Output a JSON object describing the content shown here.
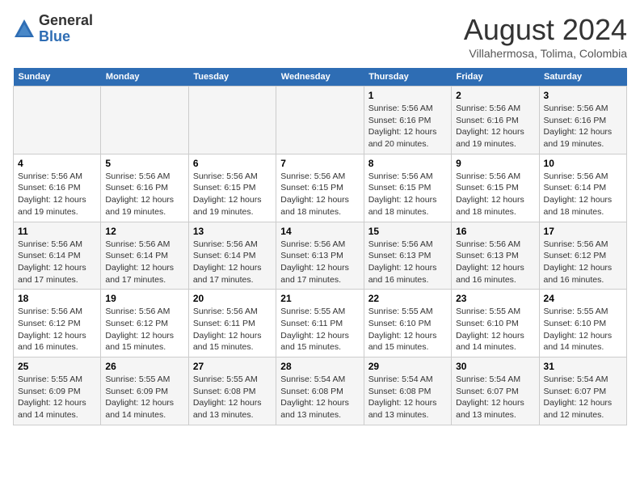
{
  "header": {
    "logo_general": "General",
    "logo_blue": "Blue",
    "month_year": "August 2024",
    "location": "Villahermosa, Tolima, Colombia"
  },
  "weekdays": [
    "Sunday",
    "Monday",
    "Tuesday",
    "Wednesday",
    "Thursday",
    "Friday",
    "Saturday"
  ],
  "weeks": [
    [
      {
        "day": "",
        "info": ""
      },
      {
        "day": "",
        "info": ""
      },
      {
        "day": "",
        "info": ""
      },
      {
        "day": "",
        "info": ""
      },
      {
        "day": "1",
        "info": "Sunrise: 5:56 AM\nSunset: 6:16 PM\nDaylight: 12 hours\nand 20 minutes."
      },
      {
        "day": "2",
        "info": "Sunrise: 5:56 AM\nSunset: 6:16 PM\nDaylight: 12 hours\nand 19 minutes."
      },
      {
        "day": "3",
        "info": "Sunrise: 5:56 AM\nSunset: 6:16 PM\nDaylight: 12 hours\nand 19 minutes."
      }
    ],
    [
      {
        "day": "4",
        "info": "Sunrise: 5:56 AM\nSunset: 6:16 PM\nDaylight: 12 hours\nand 19 minutes."
      },
      {
        "day": "5",
        "info": "Sunrise: 5:56 AM\nSunset: 6:16 PM\nDaylight: 12 hours\nand 19 minutes."
      },
      {
        "day": "6",
        "info": "Sunrise: 5:56 AM\nSunset: 6:15 PM\nDaylight: 12 hours\nand 19 minutes."
      },
      {
        "day": "7",
        "info": "Sunrise: 5:56 AM\nSunset: 6:15 PM\nDaylight: 12 hours\nand 18 minutes."
      },
      {
        "day": "8",
        "info": "Sunrise: 5:56 AM\nSunset: 6:15 PM\nDaylight: 12 hours\nand 18 minutes."
      },
      {
        "day": "9",
        "info": "Sunrise: 5:56 AM\nSunset: 6:15 PM\nDaylight: 12 hours\nand 18 minutes."
      },
      {
        "day": "10",
        "info": "Sunrise: 5:56 AM\nSunset: 6:14 PM\nDaylight: 12 hours\nand 18 minutes."
      }
    ],
    [
      {
        "day": "11",
        "info": "Sunrise: 5:56 AM\nSunset: 6:14 PM\nDaylight: 12 hours\nand 17 minutes."
      },
      {
        "day": "12",
        "info": "Sunrise: 5:56 AM\nSunset: 6:14 PM\nDaylight: 12 hours\nand 17 minutes."
      },
      {
        "day": "13",
        "info": "Sunrise: 5:56 AM\nSunset: 6:14 PM\nDaylight: 12 hours\nand 17 minutes."
      },
      {
        "day": "14",
        "info": "Sunrise: 5:56 AM\nSunset: 6:13 PM\nDaylight: 12 hours\nand 17 minutes."
      },
      {
        "day": "15",
        "info": "Sunrise: 5:56 AM\nSunset: 6:13 PM\nDaylight: 12 hours\nand 16 minutes."
      },
      {
        "day": "16",
        "info": "Sunrise: 5:56 AM\nSunset: 6:13 PM\nDaylight: 12 hours\nand 16 minutes."
      },
      {
        "day": "17",
        "info": "Sunrise: 5:56 AM\nSunset: 6:12 PM\nDaylight: 12 hours\nand 16 minutes."
      }
    ],
    [
      {
        "day": "18",
        "info": "Sunrise: 5:56 AM\nSunset: 6:12 PM\nDaylight: 12 hours\nand 16 minutes."
      },
      {
        "day": "19",
        "info": "Sunrise: 5:56 AM\nSunset: 6:12 PM\nDaylight: 12 hours\nand 15 minutes."
      },
      {
        "day": "20",
        "info": "Sunrise: 5:56 AM\nSunset: 6:11 PM\nDaylight: 12 hours\nand 15 minutes."
      },
      {
        "day": "21",
        "info": "Sunrise: 5:55 AM\nSunset: 6:11 PM\nDaylight: 12 hours\nand 15 minutes."
      },
      {
        "day": "22",
        "info": "Sunrise: 5:55 AM\nSunset: 6:10 PM\nDaylight: 12 hours\nand 15 minutes."
      },
      {
        "day": "23",
        "info": "Sunrise: 5:55 AM\nSunset: 6:10 PM\nDaylight: 12 hours\nand 14 minutes."
      },
      {
        "day": "24",
        "info": "Sunrise: 5:55 AM\nSunset: 6:10 PM\nDaylight: 12 hours\nand 14 minutes."
      }
    ],
    [
      {
        "day": "25",
        "info": "Sunrise: 5:55 AM\nSunset: 6:09 PM\nDaylight: 12 hours\nand 14 minutes."
      },
      {
        "day": "26",
        "info": "Sunrise: 5:55 AM\nSunset: 6:09 PM\nDaylight: 12 hours\nand 14 minutes."
      },
      {
        "day": "27",
        "info": "Sunrise: 5:55 AM\nSunset: 6:08 PM\nDaylight: 12 hours\nand 13 minutes."
      },
      {
        "day": "28",
        "info": "Sunrise: 5:54 AM\nSunset: 6:08 PM\nDaylight: 12 hours\nand 13 minutes."
      },
      {
        "day": "29",
        "info": "Sunrise: 5:54 AM\nSunset: 6:08 PM\nDaylight: 12 hours\nand 13 minutes."
      },
      {
        "day": "30",
        "info": "Sunrise: 5:54 AM\nSunset: 6:07 PM\nDaylight: 12 hours\nand 13 minutes."
      },
      {
        "day": "31",
        "info": "Sunrise: 5:54 AM\nSunset: 6:07 PM\nDaylight: 12 hours\nand 12 minutes."
      }
    ]
  ]
}
